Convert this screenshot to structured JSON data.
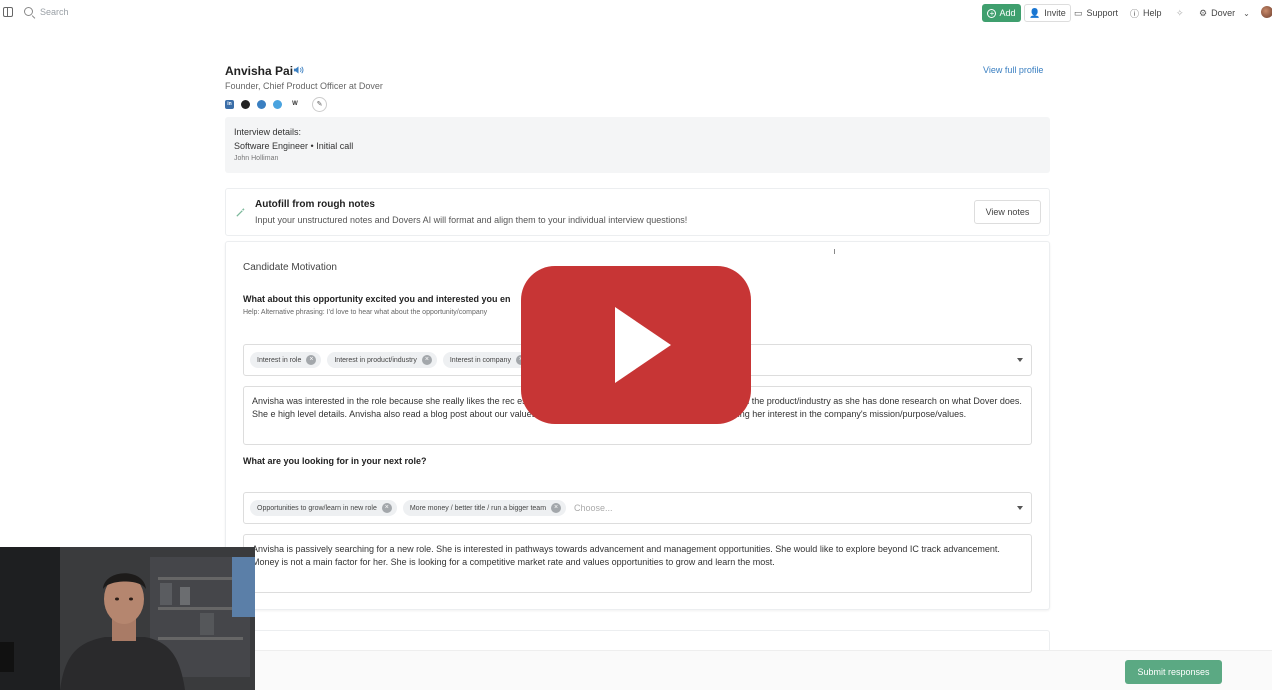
{
  "topbar": {
    "search_placeholder": "Search",
    "add_label": "Add",
    "invite_label": "Invite",
    "support_label": "Support",
    "help_label": "Help",
    "account_label": "Dover"
  },
  "profile": {
    "name": "Anvisha Pai",
    "subtitle": "Founder, Chief Product Officer at Dover",
    "view_full_profile": "View full profile",
    "social_icons": [
      "linkedin-icon",
      "github-icon",
      "personal-site-icon",
      "twitter-icon",
      "wikipedia-icon"
    ]
  },
  "interview": {
    "label": "Interview details:",
    "value": "Software Engineer • Initial call",
    "interviewer": "John Holliman"
  },
  "autofill": {
    "title": "Autofill from rough notes",
    "description": "Input your unstructured notes and Dovers AI will format and align them to your individual interview questions!",
    "button": "View notes"
  },
  "section": {
    "title": "Candidate Motivation",
    "q1": {
      "question": "What about this opportunity excited you and interested you en",
      "help": "Help: Alternative phrasing: I'd love to hear what about the opportunity/company",
      "chips": [
        "Interest in role",
        "Interest in product/industry",
        "Interest in company"
      ],
      "answer": "Anvisha was interested in the role because she really likes the rec ess with her team at Dropbox. She also showed interest in the product/industry as she has done research on what Dover does. She e high level details. Anvisha also read a blog post about our values and really liked the one about 'gotta go fast', showing her interest in the company's mission/purpose/values."
    },
    "q2": {
      "question": "What are you looking for in your next role?",
      "chips": [
        "Opportunities to grow/learn in new role",
        "More money / better title / run a bigger team"
      ],
      "choose_placeholder": "Choose...",
      "answer": "Anvisha is passively searching for a new role. She is interested in pathways towards advancement and management opportunities. She would like to explore beyond IC track advancement. Money is not a main factor for her. She is looking for a competitive market rate and values opportunities to grow and learn the most."
    }
  },
  "footer": {
    "submit": "Submit responses"
  },
  "colors": {
    "accent_green": "#3f9f6e",
    "submit_green": "#5ba983",
    "link_blue": "#3a7fc1",
    "play_red": "#c73535"
  }
}
